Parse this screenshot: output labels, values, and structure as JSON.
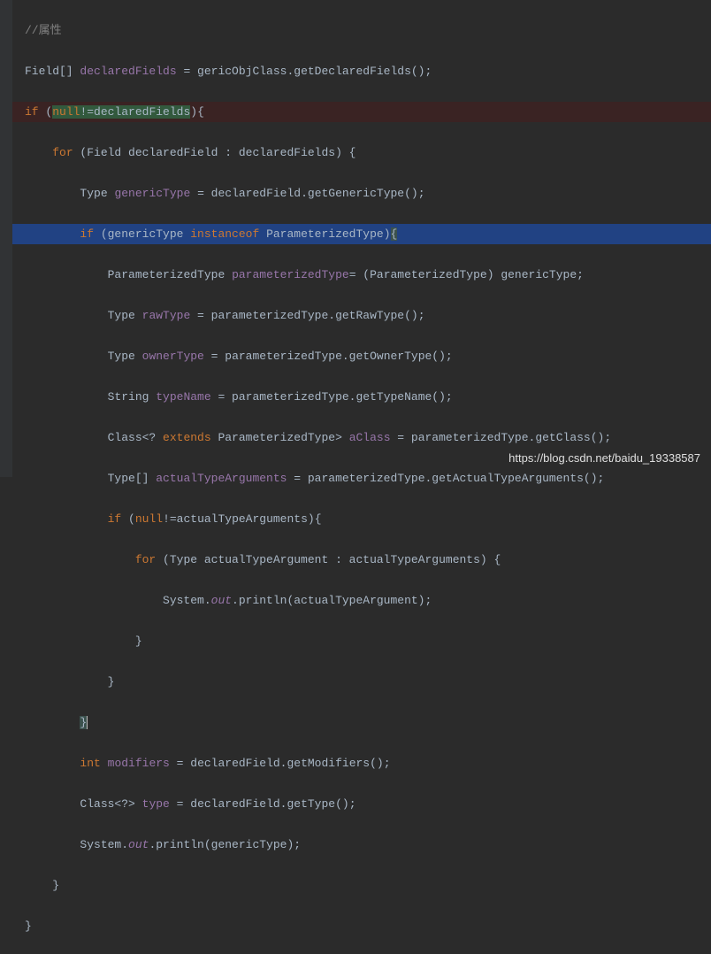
{
  "watermark": "https://blog.csdn.net/baidu_19338587",
  "code": {
    "comment_prop": "//属性",
    "l2": {
      "p1": "Field[] ",
      "p2": "declaredFields",
      "p3": " = gericObjClass.getDeclaredFields();"
    },
    "l3": {
      "kw_if": "if",
      "paren_open": " (",
      "null_kw": "null",
      "neq": "!=",
      "var": "declaredFields",
      "paren_close": ")",
      "brace": "{"
    },
    "l4": {
      "indent": "    ",
      "kw_for": "for",
      "rest": " (Field declaredField : declaredFields) {"
    },
    "l5": {
      "indent": "        ",
      "p1": "Type ",
      "var": "genericType",
      "p2": " = declaredField.getGenericType();"
    },
    "l6": {
      "indent": "        ",
      "kw_if": "if",
      "p1": " (genericType ",
      "kw_instanceof": "instanceof",
      "p2": " ParameterizedType)",
      "brace": "{"
    },
    "l7": {
      "indent": "            ",
      "p1": "ParameterizedType ",
      "var": "parameterizedType",
      "p2": "= (ParameterizedType) genericType;"
    },
    "l8": {
      "indent": "            ",
      "p1": "Type ",
      "var": "rawType",
      "p2": " = parameterizedType.getRawType();"
    },
    "l9": {
      "indent": "            ",
      "p1": "Type ",
      "var": "ownerType",
      "p2": " = parameterizedType.getOwnerType();"
    },
    "l10": {
      "indent": "            ",
      "p1": "String ",
      "var": "typeName",
      "p2": " = parameterizedType.getTypeName();"
    },
    "l11": {
      "indent": "            ",
      "p1": "Class<? ",
      "kw_extends": "extends",
      "p2": " ParameterizedType> ",
      "var": "aClass",
      "p3": " = parameterizedType.getClass();"
    },
    "l12": {
      "indent": "            ",
      "p1": "Type[] ",
      "var": "actualTypeArguments",
      "p2": " = parameterizedType.getActualTypeArguments();"
    },
    "l13": {
      "indent": "            ",
      "kw_if": "if",
      "p1": " (",
      "null_kw": "null",
      "p2": "!=actualTypeArguments){"
    },
    "l14": {
      "indent": "                ",
      "kw_for": "for",
      "rest": " (Type actualTypeArgument : actualTypeArguments) {"
    },
    "l15": {
      "indent": "                    ",
      "p1": "System.",
      "out": "out",
      "p2": ".println(actualTypeArgument);"
    },
    "l16": {
      "indent": "                ",
      "brace": "}"
    },
    "l17": {
      "indent": "            ",
      "brace": "}"
    },
    "l18": {
      "indent": "        ",
      "brace": "}"
    },
    "l19": {
      "indent": "        ",
      "kw_int": "int",
      "p1": " ",
      "var": "modifiers",
      "p2": " = declaredField.getModifiers();"
    },
    "l20": {
      "indent": "        ",
      "p1": "Class<?> ",
      "var": "type",
      "p2": " = declaredField.getType();"
    },
    "l21": {
      "indent": "        ",
      "p1": "System.",
      "out": "out",
      "p2": ".println(genericType);"
    },
    "l22": {
      "indent": "    ",
      "brace": "}"
    },
    "l23": {
      "brace": "}"
    }
  }
}
